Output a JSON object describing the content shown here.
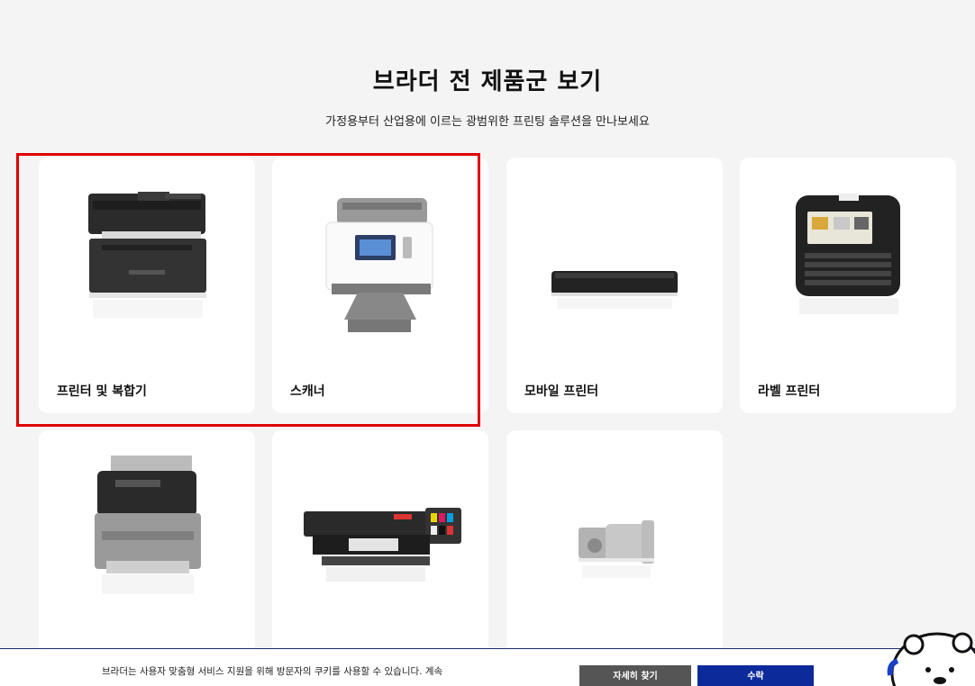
{
  "header": {
    "title": "브라더 전 제품군 보기",
    "subtitle": "가정용부터 산업용에 이르는 광범위한 프린팅 솔루션을 만나보세요"
  },
  "products": [
    {
      "label": "프린터 및 복합기",
      "icon": "mfc-printer-image"
    },
    {
      "label": "스캐너",
      "icon": "scanner-image"
    },
    {
      "label": "모바일 프린터",
      "icon": "mobile-printer-image"
    },
    {
      "label": "라벨 프린터",
      "icon": "label-printer-image"
    },
    {
      "label": "",
      "icon": "fax-machine-image"
    },
    {
      "label": "",
      "icon": "garment-printer-image"
    },
    {
      "label": "",
      "icon": "gear-motor-image"
    }
  ],
  "cookie_bar": {
    "text": "브라더는 사용자 맞춤형 서비스 지원을 위해 방문자의 쿠키를 사용할 수 있습니다. 계속",
    "details_label": "자세히 찾기",
    "accept_label": "수락"
  },
  "colors": {
    "highlight": "#e00000",
    "accept": "#0d2a9b",
    "details": "#555555"
  }
}
